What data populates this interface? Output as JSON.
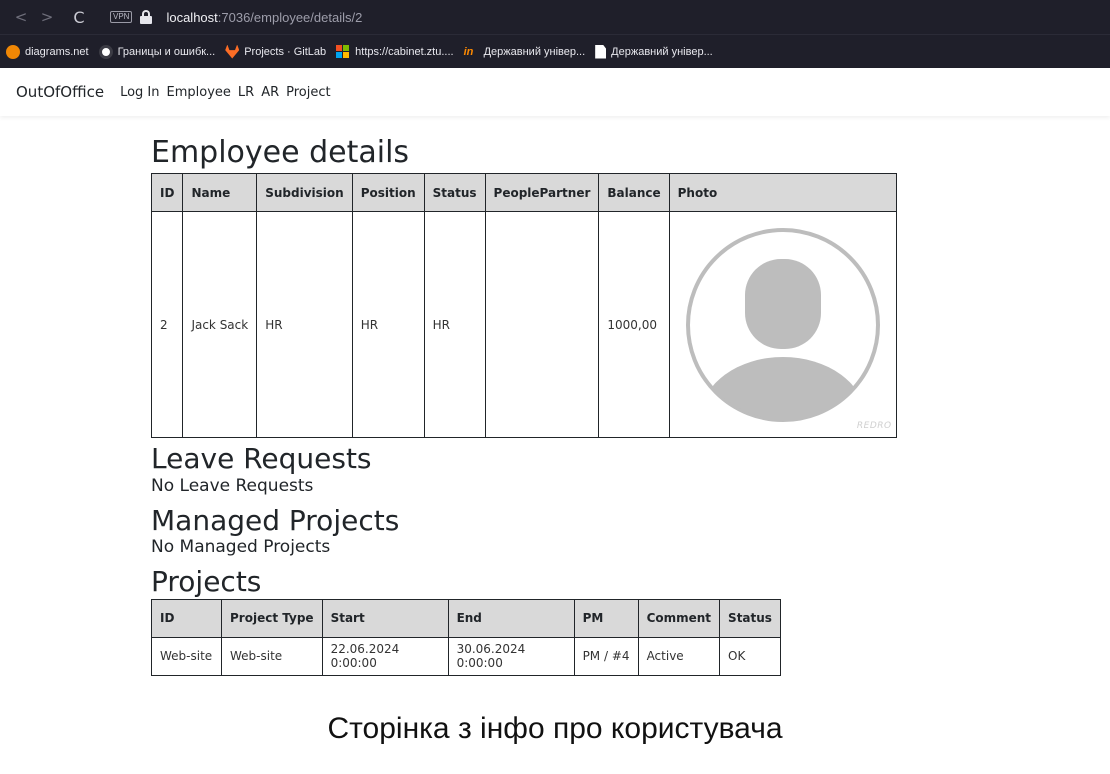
{
  "browser": {
    "back": "<",
    "forward": ">",
    "reload": "C",
    "vpn": "VPN",
    "url_host": "localhost",
    "url_path": ":7036/employee/details/2",
    "bookmarks": [
      {
        "label": "diagrams.net",
        "icon": "diagrams-icon"
      },
      {
        "label": "Границы и ошибк...",
        "icon": "openai-icon"
      },
      {
        "label": "Projects · GitLab",
        "icon": "gitlab-icon"
      },
      {
        "label": "https://cabinet.ztu....",
        "icon": "microsoft-icon"
      },
      {
        "label": "Державний універ...",
        "icon": "in-icon"
      },
      {
        "label": "Державний універ...",
        "icon": "document-icon"
      }
    ]
  },
  "navbar": {
    "brand": "OutOfOffice",
    "links": [
      "Log In",
      "Employee",
      "LR",
      "AR",
      "Project"
    ]
  },
  "employee": {
    "title": "Employee details",
    "headers": [
      "ID",
      "Name",
      "Subdivision",
      "Position",
      "Status",
      "PeoplePartner",
      "Balance",
      "Photo"
    ],
    "row": {
      "id": "2",
      "name": "Jack Sack",
      "subdivision": "HR",
      "position": "HR",
      "status": "HR",
      "people_partner": "",
      "balance": "1000,00"
    },
    "photo_watermark": "REDRO"
  },
  "leave_requests": {
    "title": "Leave Requests",
    "empty": "No Leave Requests"
  },
  "managed_projects": {
    "title": "Managed Projects",
    "empty": "No Managed Projects"
  },
  "projects": {
    "title": "Projects",
    "headers": [
      "ID",
      "Project Type",
      "Start",
      "End",
      "PM",
      "Comment",
      "Status"
    ],
    "rows": [
      [
        "Web-site",
        "Web-site",
        "22.06.2024 0:00:00",
        "30.06.2024 0:00:00",
        "PM / #4",
        "Active",
        "OK"
      ]
    ]
  },
  "caption": "Сторінка з інфо про користувача",
  "colors": {
    "chrome_bg": "#1f1f2a",
    "table_header_bg": "#d9d9d9",
    "avatar_gray": "#bdbdbd"
  }
}
